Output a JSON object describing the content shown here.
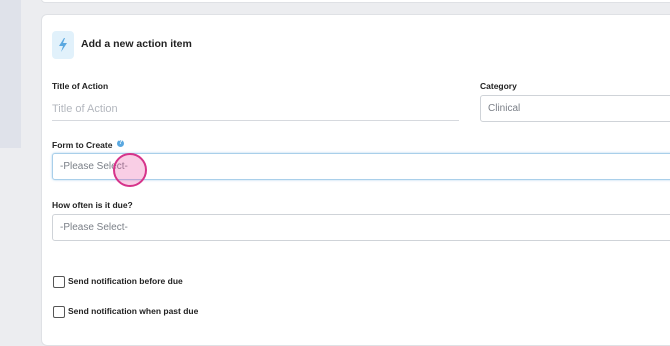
{
  "form": {
    "header_title": "Add a new action item",
    "header_icon": "lightning-icon",
    "title_of_action": {
      "label": "Title of Action",
      "placeholder": "Title of Action",
      "value": ""
    },
    "category": {
      "label": "Category",
      "value": "Clinical"
    },
    "form_to_create": {
      "label": "Form to Create",
      "help_icon": "question-icon",
      "help_glyph": "?",
      "value": "-Please Select-"
    },
    "frequency": {
      "label": "How often is it due?",
      "value": "-Please Select-"
    },
    "notify_before_due": {
      "label": "Send notification before due",
      "checked": false
    },
    "notify_past_due": {
      "label": "Send notification when past due",
      "checked": false
    }
  },
  "colors": {
    "accent": "#5aa8e0",
    "icon_bg": "#e1f1fb",
    "click_marker": "#d6338a"
  }
}
